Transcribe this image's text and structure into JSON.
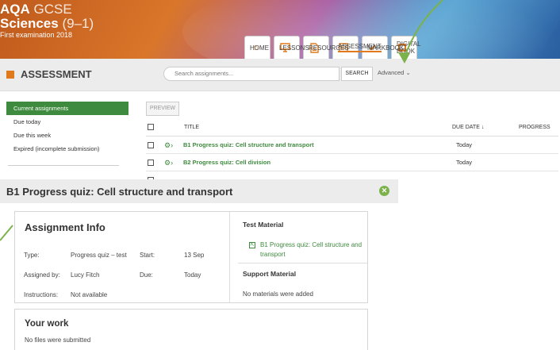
{
  "logo": {
    "aqa": "AQA",
    "gcse": "GCSE",
    "sciences": "Sciences",
    "grade": "(9–1)",
    "exam": "First examination 2018"
  },
  "tabs": [
    {
      "label": "HOME",
      "icon": "home-icon"
    },
    {
      "label": "LESSONS",
      "icon": "lessons-icon"
    },
    {
      "label": "RESOURCES",
      "icon": "resources-icon"
    },
    {
      "label": "ASSESSMENT",
      "icon": "assessment-icon"
    },
    {
      "label": "MARKBOOK",
      "icon": "markbook-icon"
    },
    {
      "label": "DIGITAL BOOK",
      "icon": "digital-book-icon"
    }
  ],
  "page": {
    "title": "ASSESSMENT"
  },
  "search": {
    "placeholder": "Search assignments...",
    "button": "SEARCH",
    "advanced": "Advanced"
  },
  "sidebar": {
    "items": [
      {
        "label": "Current assignments"
      },
      {
        "label": "Due today"
      },
      {
        "label": "Due this week"
      },
      {
        "label": "Expired (incomplete submission)"
      }
    ]
  },
  "table": {
    "preview_button": "PREVIEW",
    "headers": {
      "title": "TITLE",
      "due": "DUE DATE",
      "progress": "PROGRESS"
    },
    "rows": [
      {
        "title": "B1 Progress quiz: Cell structure and transport",
        "due": "Today"
      },
      {
        "title": "B2 Progress quiz: Cell division",
        "due": "Today"
      }
    ]
  },
  "overlay": {
    "title": "B1 Progress quiz: Cell structure and transport",
    "info": {
      "heading": "Assignment Info",
      "type_label": "Type:",
      "type_value": "Progress quiz – test",
      "start_label": "Start:",
      "start_value": "13 Sep",
      "assigned_label": "Assigned by:",
      "assigned_value": "Lucy Fitch",
      "due_label": "Due:",
      "due_value": "Today",
      "instructions_label": "Instructions:",
      "instructions_value": "Not available"
    },
    "test_material": {
      "heading": "Test Material",
      "link": "B1 Progress quiz: Cell structure and transport"
    },
    "support_material": {
      "heading": "Support Material",
      "none": "No materials were added"
    },
    "your_work": {
      "heading": "Your work",
      "none": "No files were submitted"
    }
  },
  "colors": {
    "accent": "#e07a1c",
    "green": "#3e8a3e",
    "callout_arrow": "#7cb24a"
  }
}
